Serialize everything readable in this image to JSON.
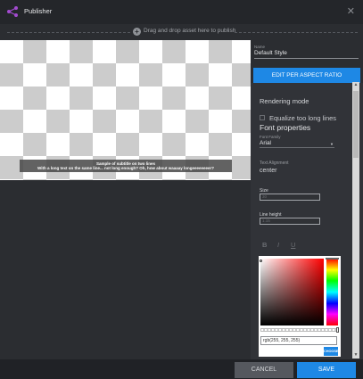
{
  "window": {
    "title": "Publisher",
    "app_icon": "share-icon",
    "close_icon": "close-icon",
    "close_glyph": "✕"
  },
  "dropzone": {
    "plus_glyph": "+",
    "hint": "Drag and drop asset here to publish"
  },
  "preview": {
    "subtitle_line1": "Sample of subtitle on two lines",
    "subtitle_line2": "With a long text on the same line... not long enough? Oh, how about waaaay longeeeeeeeer?"
  },
  "panel": {
    "name_label": "Name",
    "name_value": "Default Style",
    "edit_button": "EDIT PER ASPECT RATIO",
    "rendering_mode": "Rendering mode",
    "equalize_label": "Equalize too long lines",
    "equalize_checked": false,
    "font_properties": "Font properties",
    "font_family_label": "Font Family",
    "font_family_value": "Arial",
    "dropdown_glyph": "▼",
    "text_alignment_label": "Text Alignment",
    "text_alignment_value": "center",
    "size_label": "Size",
    "size_value": "30",
    "line_height_label": "Line height",
    "line_height_value": "1.15",
    "bold_glyph": "B",
    "italic_glyph": "I",
    "underline_glyph": "U"
  },
  "color_picker": {
    "value": "rgb(255, 255, 255)",
    "choose_button": "CHOOSE",
    "alpha": 1.0
  },
  "scrollbar": {
    "up_glyph": "▲",
    "down_glyph": "▼"
  },
  "footer": {
    "cancel_label": "CANCEL",
    "save_label": "SAVE"
  },
  "colors": {
    "accent": "#1e88e5",
    "app_icon": "#a34bd0",
    "background": "#2b2d31"
  }
}
